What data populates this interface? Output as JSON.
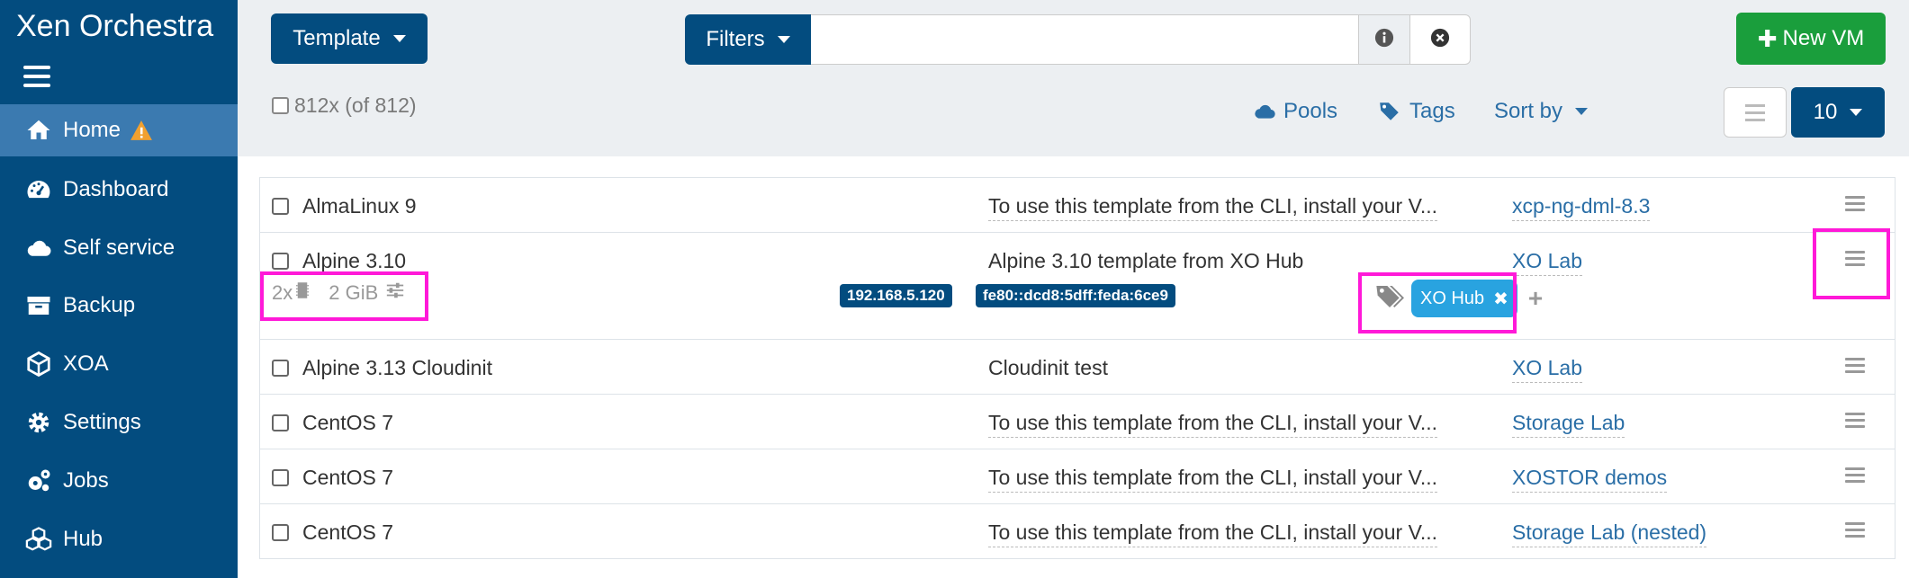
{
  "app": {
    "title": "Xen Orchestra"
  },
  "sidebar": {
    "items": [
      {
        "label": "Home",
        "icon": "home-icon",
        "active": true,
        "warning": true
      },
      {
        "label": "Dashboard",
        "icon": "dashboard-icon"
      },
      {
        "label": "Self service",
        "icon": "cloud-icon"
      },
      {
        "label": "Backup",
        "icon": "archive-icon"
      },
      {
        "label": "XOA",
        "icon": "xoa-icon"
      },
      {
        "label": "Settings",
        "icon": "gear-icon"
      },
      {
        "label": "Jobs",
        "icon": "cogs-icon"
      },
      {
        "label": "Hub",
        "icon": "cubes-icon"
      }
    ]
  },
  "toolbar": {
    "type_label": "Template",
    "filters_label": "Filters",
    "filter_value": "",
    "new_vm_label": "New VM",
    "select_all_label": "812x (of 812)",
    "pools_label": "Pools",
    "tags_label": "Tags",
    "sort_label": "Sort by",
    "page_size": "10"
  },
  "colors": {
    "primary": "#034c7f",
    "success": "#1a9e3c",
    "tag": "#29a3e0",
    "highlight": "#ff19d8"
  },
  "rows": [
    {
      "name": "AlmaLinux 9",
      "description": "To use this template from the CLI, install your V...",
      "pool": "xcp-ng-dml-8.3"
    },
    {
      "name": "Alpine 3.10",
      "description": "Alpine 3.10 template from XO Hub",
      "pool": "XO Lab",
      "cpus": "2x",
      "memory": "2 GiB",
      "ipv4": "192.168.5.120",
      "ipv6": "fe80::dcd8:5dff:feda:6ce9",
      "tags": [
        "XO Hub"
      ]
    },
    {
      "name": "Alpine 3.13 Cloudinit",
      "description": "Cloudinit test",
      "pool": "XO Lab"
    },
    {
      "name": "CentOS 7",
      "description": "To use this template from the CLI, install your V...",
      "pool": "Storage Lab"
    },
    {
      "name": "CentOS 7",
      "description": "To use this template from the CLI, install your V...",
      "pool": "XOSTOR demos"
    },
    {
      "name": "CentOS 7",
      "description": "To use this template from the CLI, install your V...",
      "pool": "Storage Lab (nested)"
    }
  ]
}
